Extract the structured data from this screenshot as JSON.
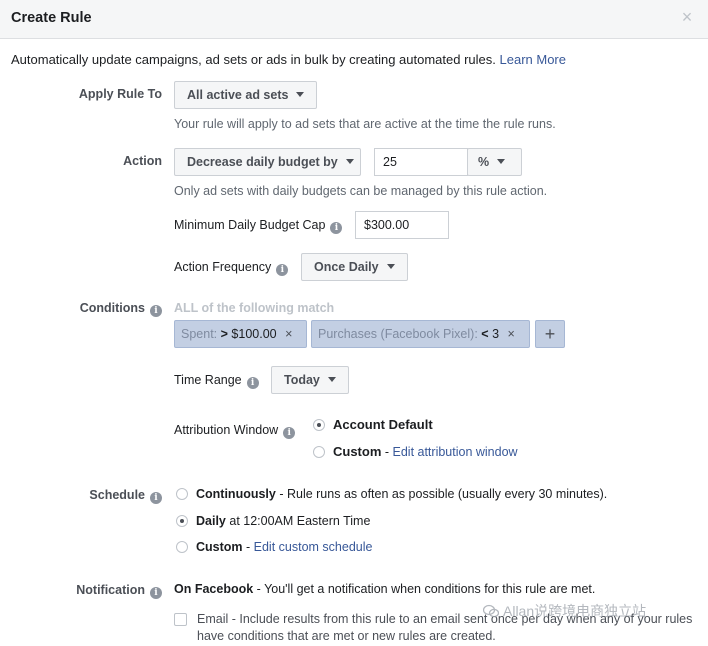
{
  "dialog": {
    "title": "Create Rule",
    "close": "×",
    "intro": "Automatically update campaigns, ad sets or ads in bulk by creating automated rules. ",
    "learn_more": "Learn More"
  },
  "apply_rule_to": {
    "label": "Apply Rule To",
    "value": "All active ad sets",
    "help": "Your rule will apply to ad sets that are active at the time the rule runs."
  },
  "action": {
    "label": "Action",
    "value": "Decrease daily budget by",
    "amount": "25",
    "unit": "%",
    "help": "Only ad sets with daily budgets can be managed by this rule action.",
    "min_cap_label": "Minimum Daily Budget Cap",
    "min_cap_value": "$300.00",
    "frequency_label": "Action Frequency",
    "frequency_value": "Once Daily"
  },
  "conditions": {
    "label": "Conditions",
    "match_text": "ALL of the following match",
    "chip1_metric": "Spent:",
    "chip1_operator": ">",
    "chip1_value": "$100.00",
    "chip2_metric": "Purchases (Facebook Pixel):",
    "chip2_operator": "<",
    "chip2_value": "3",
    "remove": "×",
    "add": "+"
  },
  "time_range": {
    "label": "Time Range",
    "value": "Today"
  },
  "attribution": {
    "label": "Attribution Window",
    "option1": "Account Default",
    "option2": "Custom",
    "option2_sep": " - ",
    "option2_link": "Edit attribution window"
  },
  "schedule": {
    "label": "Schedule",
    "continuously": "Continuously",
    "continuously_desc": " - Rule runs as often as possible (usually every 30 minutes).",
    "daily": "Daily",
    "daily_desc": " at 12:00AM Eastern Time",
    "custom": "Custom",
    "custom_sep": " - ",
    "custom_link": "Edit custom schedule"
  },
  "notification": {
    "label": "Notification",
    "facebook": "On Facebook",
    "facebook_desc": " - You'll get a notification when conditions for this rule are met.",
    "email": "Email",
    "email_desc_line1": " - Include results from this rule to an email sent once per day when any of your rules",
    "email_desc_line2": "have conditions that are met or new rules are created."
  },
  "watermark": {
    "text": "Allan说跨境电商独立站"
  },
  "info_glyph": "i"
}
